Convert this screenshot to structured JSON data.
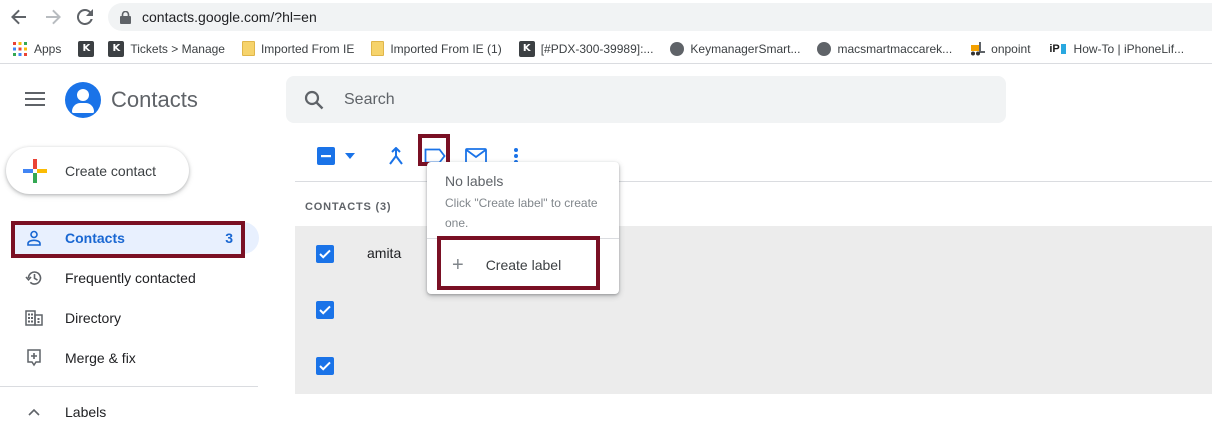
{
  "browser": {
    "url": "contacts.google.com/?hl=en",
    "bookmarks": [
      {
        "label": "Apps",
        "icon": "apps-grid-icon"
      },
      {
        "label": "",
        "icon": "k-favicon"
      },
      {
        "label": "Tickets > Manage",
        "icon": "k-favicon"
      },
      {
        "label": "Imported From IE",
        "icon": "folder-icon"
      },
      {
        "label": "Imported From IE (1)",
        "icon": "folder-icon"
      },
      {
        "label": "[#PDX-300-39989]:...",
        "icon": "k-favicon"
      },
      {
        "label": "KeymanagerSmart...",
        "icon": "globe-icon"
      },
      {
        "label": "macsmartmaccarek...",
        "icon": "globe-icon"
      },
      {
        "label": "onpoint",
        "icon": "forklift-icon"
      },
      {
        "label": "How-To | iPhoneLif...",
        "icon": "ip-favicon"
      }
    ]
  },
  "app": {
    "title": "Contacts",
    "search_placeholder": "Search"
  },
  "sidebar": {
    "create_label": "Create contact",
    "items": [
      {
        "label": "Contacts",
        "count": "3",
        "icon": "person-icon",
        "active": true
      },
      {
        "label": "Frequently contacted",
        "icon": "history-icon"
      },
      {
        "label": "Directory",
        "icon": "building-icon"
      },
      {
        "label": "Merge & fix",
        "icon": "merge-fix-icon"
      }
    ],
    "labels_header": "Labels"
  },
  "list": {
    "section_header": "CONTACTS (3)",
    "rows": [
      {
        "name": "amita",
        "checked": true
      },
      {
        "name": "",
        "checked": true
      },
      {
        "name": "",
        "checked": true
      }
    ]
  },
  "label_menu": {
    "title": "No labels",
    "hint": "Click \"Create label\" to create one.",
    "create_label": "Create label"
  },
  "colors": {
    "accent": "#1a73e8",
    "highlight_box": "#7a1024",
    "active_nav_bg": "#e8f0fe",
    "list_bg": "#ececec"
  }
}
